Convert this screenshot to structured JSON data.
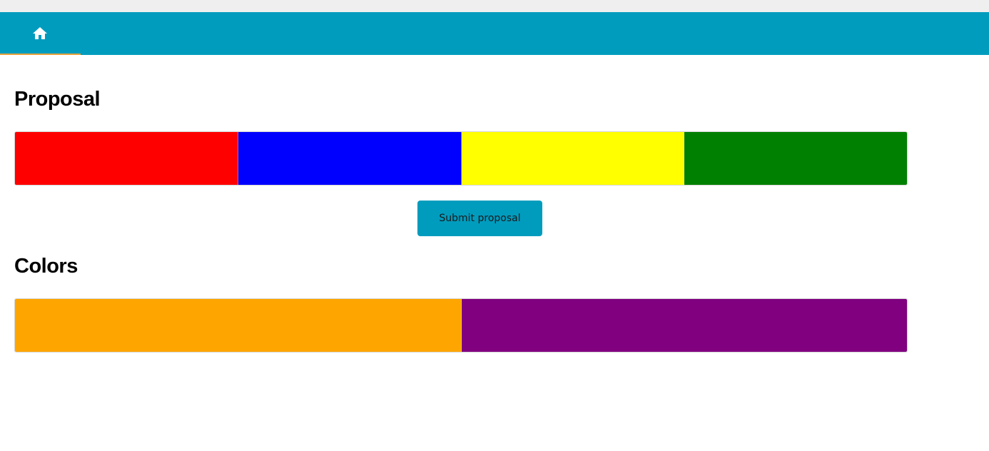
{
  "navbar": {
    "background": "#009cbe",
    "home_icon": "home-icon",
    "active_underline_color": "#e8a33d"
  },
  "proposal": {
    "title": "Proposal",
    "swatches": [
      {
        "color": "#ff0000"
      },
      {
        "color": "#0000ff"
      },
      {
        "color": "#ffff00"
      },
      {
        "color": "#008000"
      }
    ],
    "submit_label": "Submit proposal"
  },
  "colors": {
    "title": "Colors",
    "swatches": [
      {
        "color": "#ffa500"
      },
      {
        "color": "#800080"
      }
    ]
  }
}
